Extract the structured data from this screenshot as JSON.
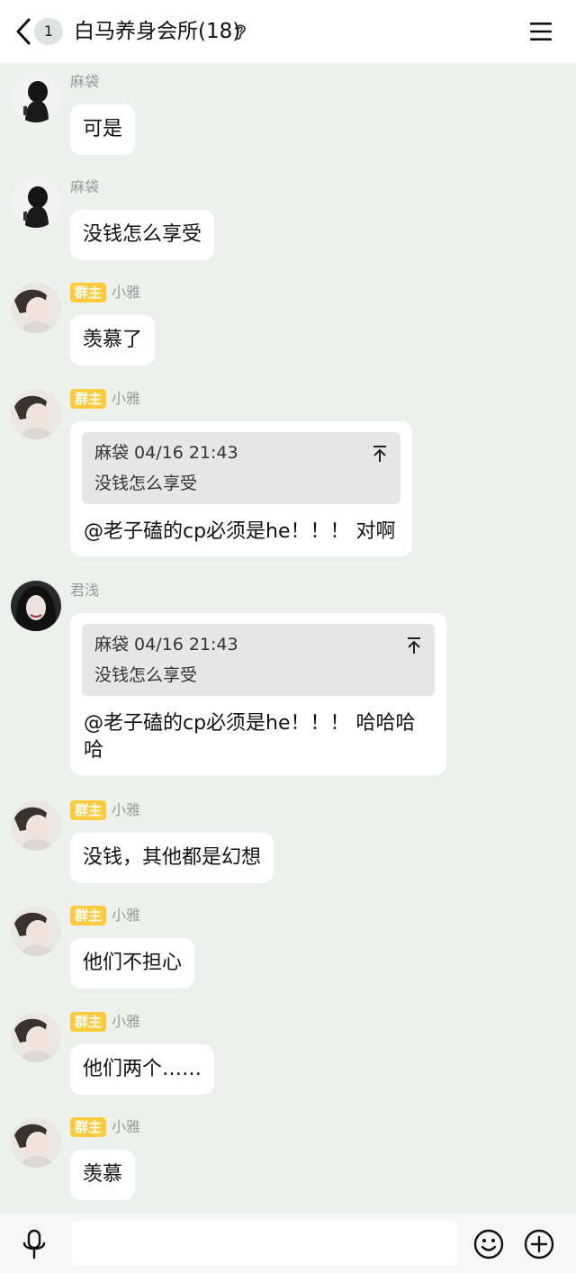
{
  "header": {
    "unread_count": "1",
    "title": "白马养身会所(18)",
    "icons": {
      "back": "chevron-left-icon",
      "ear": "ear-icon",
      "menu": "hamburger-menu-icon"
    }
  },
  "messages": [
    {
      "sender": "麻袋",
      "badge": null,
      "avatar": "avatar-madai",
      "text": "可是"
    },
    {
      "sender": "麻袋",
      "badge": null,
      "avatar": "avatar-madai",
      "text": "没钱怎么享受"
    },
    {
      "sender": "小雅",
      "badge": "群主",
      "avatar": "avatar-xiaoya",
      "text": "羡慕了"
    },
    {
      "sender": "小雅",
      "badge": "群主",
      "avatar": "avatar-xiaoya",
      "quote": {
        "head": "麻袋 04/16 21:43",
        "text": "没钱怎么享受"
      },
      "text": "@老子磕的cp必须是he！！！  对啊"
    },
    {
      "sender": "君浅",
      "badge": null,
      "avatar": "avatar-junqian",
      "quote": {
        "head": "麻袋 04/16 21:43",
        "text": "没钱怎么享受"
      },
      "text": "@老子磕的cp必须是he！！！  哈哈哈哈"
    },
    {
      "sender": "小雅",
      "badge": "群主",
      "avatar": "avatar-xiaoya",
      "text": "没钱，其他都是幻想"
    },
    {
      "sender": "小雅",
      "badge": "群主",
      "avatar": "avatar-xiaoya",
      "text": "他们不担心"
    },
    {
      "sender": "小雅",
      "badge": "群主",
      "avatar": "avatar-xiaoya",
      "text": "他们两个……"
    },
    {
      "sender": "小雅",
      "badge": "群主",
      "avatar": "avatar-xiaoya",
      "text": "羡慕"
    }
  ],
  "input_bar": {
    "message_value": "",
    "icons": {
      "voice": "microphone-icon",
      "emoji": "emoji-icon",
      "more": "plus-icon"
    }
  },
  "colors": {
    "background": "#edf1ed",
    "bubble": "#ffffff",
    "owner_badge": "#ffcb3d",
    "quote_bg": "#e6e6e6",
    "name": "#9a9a9a"
  }
}
